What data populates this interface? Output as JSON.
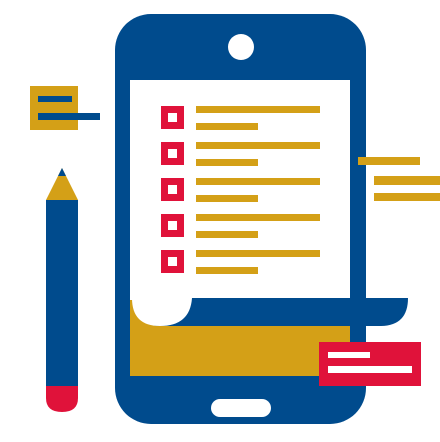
{
  "illustration": {
    "subject": "smartphone-checklist-icon",
    "colors": {
      "blue": "#004b8d",
      "gold": "#d4a017",
      "red": "#e0123a",
      "white": "#ffffff"
    },
    "checklist_items": [
      {
        "checkbox": "checkbox-1"
      },
      {
        "checkbox": "checkbox-2"
      },
      {
        "checkbox": "checkbox-3"
      },
      {
        "checkbox": "checkbox-4"
      },
      {
        "checkbox": "checkbox-5"
      }
    ]
  }
}
